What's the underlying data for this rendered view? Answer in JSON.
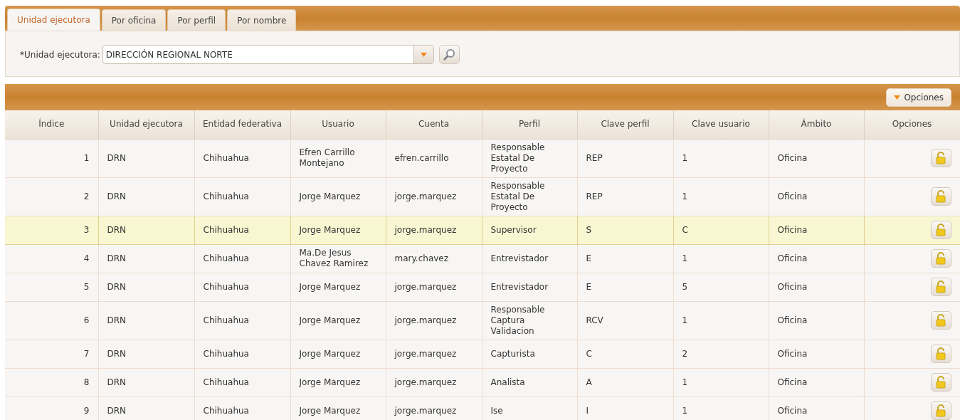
{
  "tabs": [
    {
      "label": "Unidad ejecutora",
      "selected": true
    },
    {
      "label": "Por oficina",
      "selected": false
    },
    {
      "label": "Por perfil",
      "selected": false
    },
    {
      "label": "Por nombre",
      "selected": false
    }
  ],
  "filter": {
    "label": "*Unidad ejecutora:",
    "value": "DIRECCIÓN REGIONAL NORTE"
  },
  "toolbar": {
    "options_button": "Opciones"
  },
  "table": {
    "columns": [
      "Índice",
      "Unidad ejecutora",
      "Entidad federativa",
      "Usuario",
      "Cuenta",
      "Perfil",
      "Clave perfil",
      "Clave usuario",
      "Ámbito",
      "Opciones"
    ],
    "rows": [
      {
        "selected": false,
        "cells": [
          "1",
          "DRN",
          "Chihuahua",
          "Efren Carrillo Montejano",
          "efren.carrillo",
          "Responsable Estatal De Proyecto",
          "REP",
          "1",
          "Oficina"
        ]
      },
      {
        "selected": false,
        "cells": [
          "2",
          "DRN",
          "Chihuahua",
          "Jorge Marquez",
          "jorge.marquez",
          "Responsable Estatal De Proyecto",
          "REP",
          "1",
          "Oficina"
        ]
      },
      {
        "selected": true,
        "cells": [
          "3",
          "DRN",
          "Chihuahua",
          "Jorge Marquez",
          "jorge.marquez",
          "Supervisor",
          "S",
          "C",
          "Oficina"
        ]
      },
      {
        "selected": false,
        "cells": [
          "4",
          "DRN",
          "Chihuahua",
          "Ma.De Jesus Chavez Ramirez",
          "mary.chavez",
          "Entrevistador",
          "E",
          "1",
          "Oficina"
        ]
      },
      {
        "selected": false,
        "cells": [
          "5",
          "DRN",
          "Chihuahua",
          "Jorge Marquez",
          "jorge.marquez",
          "Entrevistador",
          "E",
          "5",
          "Oficina"
        ]
      },
      {
        "selected": false,
        "cells": [
          "6",
          "DRN",
          "Chihuahua",
          "Jorge Marquez",
          "jorge.marquez",
          "Responsable Captura Validacion",
          "RCV",
          "1",
          "Oficina"
        ]
      },
      {
        "selected": false,
        "cells": [
          "7",
          "DRN",
          "Chihuahua",
          "Jorge Marquez",
          "jorge.marquez",
          "Capturista",
          "C",
          "2",
          "Oficina"
        ]
      },
      {
        "selected": false,
        "cells": [
          "8",
          "DRN",
          "Chihuahua",
          "Jorge Marquez",
          "jorge.marquez",
          "Analista",
          "A",
          "1",
          "Oficina"
        ]
      },
      {
        "selected": false,
        "cells": [
          "9",
          "DRN",
          "Chihuahua",
          "Jorge Marquez",
          "jorge.marquez",
          "Ise",
          "I",
          "1",
          "Oficina"
        ]
      }
    ]
  }
}
